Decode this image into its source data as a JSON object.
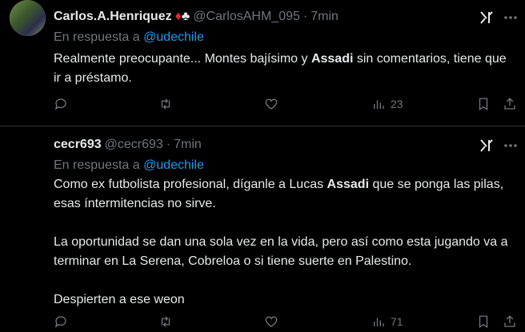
{
  "tweets": [
    {
      "name": "Carlos.A.Henriquez",
      "name_icons": "♦♣",
      "handle": "@CarlosAHM_095",
      "separator": "·",
      "time": "7min",
      "reply_prefix": "En respuesta a",
      "reply_to": "@udechile",
      "paragraphs": [
        [
          "Realmente preocupante... Montes bajísimo y ",
          "Assadi",
          " sin comentarios, tiene que ir a préstamo."
        ]
      ],
      "views": "23"
    },
    {
      "name": "cecr693",
      "handle": "@cecr693",
      "separator": "·",
      "time": "7min",
      "reply_prefix": "En respuesta a",
      "reply_to": "@udechile",
      "paragraphs": [
        [
          "Como ex futbolista profesional, díganle a Lucas ",
          "Assadi",
          " que se ponga las pilas, esas íntermitencias no sirve."
        ],
        [
          "La oportunidad se dan una sola vez en la vida, pero así como esta jugando va a terminar en La Serena, Cobreloa o si tiene suerte en Palestino."
        ],
        [
          "Despierten a ese weon"
        ]
      ],
      "views": "71"
    }
  ],
  "colors": {
    "background": "#000000",
    "text": "#e7e9ea",
    "muted": "#71767b",
    "link": "#1d9bf0",
    "suit": "#f4212e"
  },
  "icons": [
    "grok-icon",
    "more-icon",
    "reply-icon",
    "retweet-icon",
    "like-icon",
    "views-icon",
    "bookmark-icon",
    "share-icon"
  ]
}
